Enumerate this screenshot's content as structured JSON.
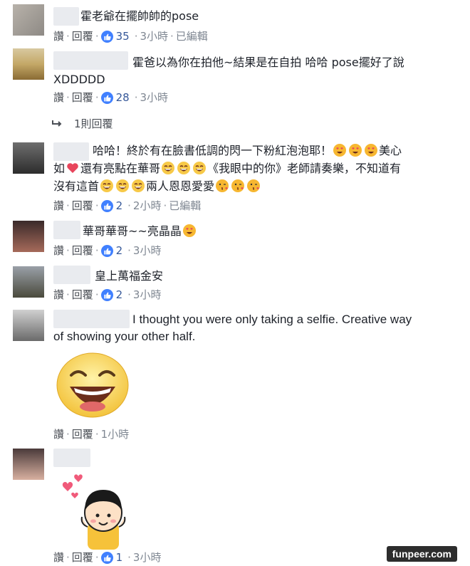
{
  "actions": {
    "like": "讚",
    "reply": "回覆"
  },
  "comments": [
    {
      "text_lines": [
        "霍老爺在擺帥帥的pose"
      ],
      "likes": "35",
      "time": "3小時",
      "edited": "已編輯"
    },
    {
      "text_lines": [
        "霍爸以為你在拍他~結果是在自拍 哈哈 pose擺好了說",
        "XDDDDD"
      ],
      "likes": "28",
      "time": "3小時",
      "reply_link": "1則回覆"
    },
    {
      "text_a": "哈哈！終於有在臉書低調的閃一下粉紅泡泡耶！",
      "text_a_end": "美心",
      "text_b1": "如",
      "text_b2": "還有亮點在華哥",
      "text_b3": "《我眼中的你》老師請奏樂，不知道有",
      "text_c1": "沒有這首",
      "text_c2": "兩人恩恩愛愛",
      "likes": "2",
      "time": "2小時",
      "edited": "已編輯"
    },
    {
      "text_lines": [
        "華哥華哥~~亮晶晶"
      ],
      "likes": "2",
      "time": "3小時"
    },
    {
      "text_lines": [
        "皇上萬福金安"
      ],
      "likes": "2",
      "time": "3小時"
    },
    {
      "text_lines": [
        "I thought you were only taking a selfie. Creative way",
        "of showing your other half."
      ],
      "time": "1小時",
      "sticker": "laughing-face-sticker"
    },
    {
      "likes": "1",
      "time": "3小時",
      "sticker": "girl-hearts-sticker"
    }
  ],
  "watermark": "funpeer.com",
  "colors": {
    "like_blue": "#4080ff",
    "link": "#365899",
    "meta": "#7f8792"
  }
}
